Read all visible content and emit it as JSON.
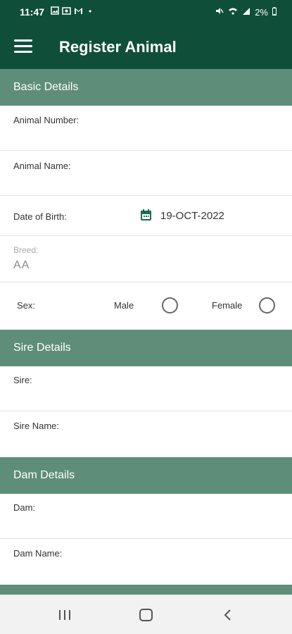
{
  "status_bar": {
    "time": "11:47",
    "battery": "2%",
    "dot": "•"
  },
  "app_bar": {
    "title": "Register Animal"
  },
  "sections": {
    "basic": "Basic Details",
    "sire": "Sire Details",
    "dam": "Dam Details"
  },
  "fields": {
    "animal_number": "Animal Number:",
    "animal_name": "Animal Name:",
    "dob_label": "Date of Birth:",
    "dob_value": "19-OCT-2022",
    "breed_caption": "Breed:",
    "breed_value": "AA",
    "sex_label": "Sex:",
    "male": "Male",
    "female": "Female",
    "sire": "Sire:",
    "sire_name": "Sire Name:",
    "dam": "Dam:",
    "dam_name": "Dam Name:"
  },
  "colors": {
    "app_bar": "#0f4f3a",
    "section_header": "#5e8e7a",
    "accent": "#1d6b4f"
  },
  "icons": [
    "menu-icon",
    "calendar-icon",
    "recents-icon",
    "home-icon",
    "back-icon"
  ]
}
